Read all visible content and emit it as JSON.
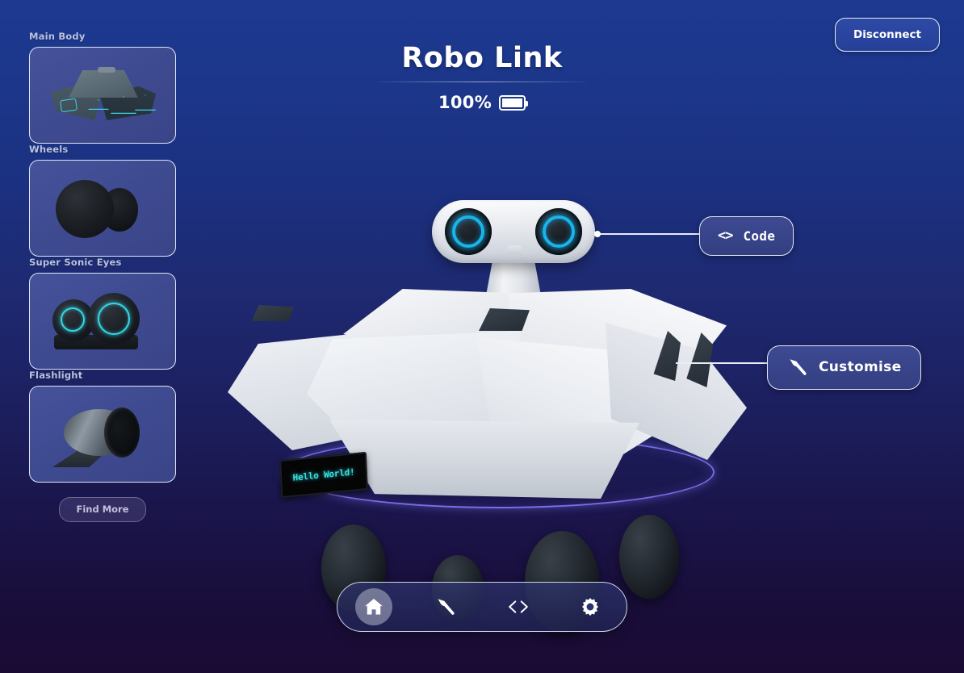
{
  "header": {
    "title": "Robo Link",
    "battery_percent": "100%",
    "battery_icon": "battery-full-icon",
    "disconnect_label": "Disconnect"
  },
  "sidebar": {
    "parts": [
      {
        "label": "Main Body",
        "thumb_icon": "robot-body-thumbnail"
      },
      {
        "label": "Wheels",
        "thumb_icon": "robot-wheels-thumbnail"
      },
      {
        "label": "Super Sonic Eyes",
        "thumb_icon": "robot-eyes-thumbnail"
      },
      {
        "label": "Flashlight",
        "thumb_icon": "robot-flashlight-thumbnail"
      }
    ],
    "find_more_label": "Find More"
  },
  "stage": {
    "robot_name": "robo-link-rover",
    "lcd_text": "Hello World!",
    "lcd_color": "#35e0e0",
    "platform_color": "#7a6de8"
  },
  "callouts": [
    {
      "label": "Code",
      "icon": "angle-brackets-icon"
    },
    {
      "label": "Customise",
      "icon": "hammer-icon"
    }
  ],
  "bottom_nav": {
    "items": [
      {
        "icon": "home-icon",
        "active": true
      },
      {
        "icon": "hammer-icon",
        "active": false
      },
      {
        "icon": "angle-brackets-icon",
        "active": false
      },
      {
        "icon": "gear-icon",
        "active": false
      }
    ]
  },
  "colors": {
    "background_top": "#1d3a91",
    "background_bottom": "#1a0b33",
    "accent_cyan": "#19b4ec",
    "accent_violet": "#7a6de8",
    "card_fill": "#414d94",
    "button_fill": "#3d4a92"
  }
}
